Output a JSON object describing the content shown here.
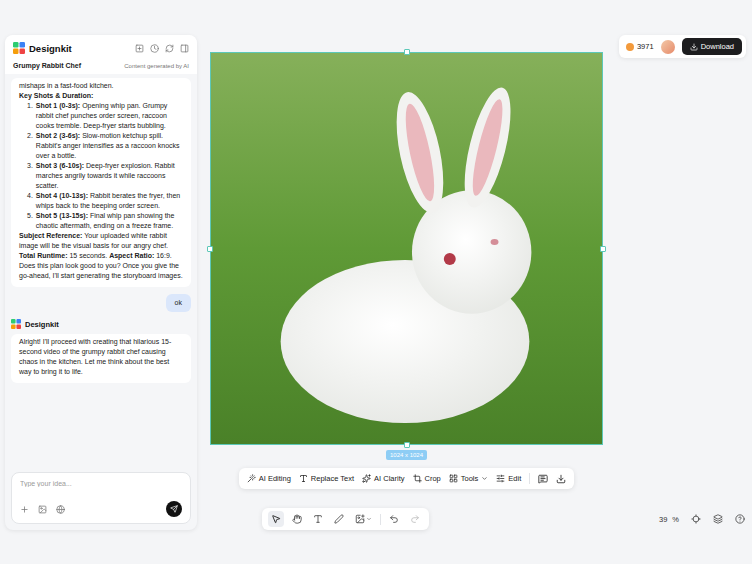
{
  "app": {
    "name": "Designkit",
    "project_title": "Grumpy Rabbit Chef",
    "ai_notice": "Content generated by AI"
  },
  "chat": {
    "intro_tail": "mishaps in a fast-food kitchen.",
    "shots_heading": "Key Shots & Duration:",
    "shots": [
      {
        "number": "1.",
        "label": "Shot 1 (0-3s):",
        "text": "Opening whip pan. Grumpy rabbit chef punches order screen, raccoon cooks tremble. Deep-fryer starts bubbling."
      },
      {
        "number": "2.",
        "label": "Shot 2 (3-6s):",
        "text": "Slow-motion ketchup spill. Rabbit's anger intensifies as a raccoon knocks over a bottle."
      },
      {
        "number": "3.",
        "label": "Shot 3 (6-10s):",
        "text": "Deep-fryer explosion. Rabbit marches angrily towards it while raccoons scatter."
      },
      {
        "number": "4.",
        "label": "Shot 4 (10-13s):",
        "text": "Rabbit berates the fryer, then whips back to the beeping order screen."
      },
      {
        "number": "5.",
        "label": "Shot 5 (13-15s):",
        "text": "Final whip pan showing the chaotic aftermath, ending on a freeze frame."
      }
    ],
    "subject": {
      "label": "Subject Reference:",
      "text": "Your uploaded white rabbit image will be the visual basis for our angry chef."
    },
    "runtime": {
      "label": "Total Runtime:",
      "text": "15 seconds."
    },
    "aspect": {
      "label": "Aspect Ratio:",
      "text": "16:9."
    },
    "question": "Does this plan look good to you? Once you give the go-ahead, I'll start generating the storyboard images.",
    "user_reply": "ok",
    "assistant_name": "Designkit",
    "assistant_reply": "Alright! I'll proceed with creating that hilarious 15-second video of the grumpy rabbit chef causing chaos in the kitchen. Let me think about the best way to bring it to life."
  },
  "input": {
    "placeholder": "Type your idea..."
  },
  "topbar": {
    "credits": "3971",
    "download": "Download"
  },
  "canvas": {
    "size_badge": "1024 x 1024"
  },
  "toolbar": [
    {
      "label": "AI Editing",
      "dropdown": false
    },
    {
      "label": "Replace Text",
      "dropdown": false
    },
    {
      "label": "AI Clarity",
      "dropdown": false
    },
    {
      "label": "Crop",
      "dropdown": false
    },
    {
      "label": "Tools",
      "dropdown": true
    },
    {
      "label": "Edit",
      "dropdown": false
    }
  ],
  "tools": [
    {
      "selected": true
    },
    {
      "selected": false
    },
    {
      "selected": false
    },
    {
      "selected": false
    },
    {
      "selected": false
    }
  ],
  "history": [
    {
      "disabled": false
    },
    {
      "disabled": true
    }
  ],
  "zoom": {
    "value": "39",
    "unit": "%"
  }
}
